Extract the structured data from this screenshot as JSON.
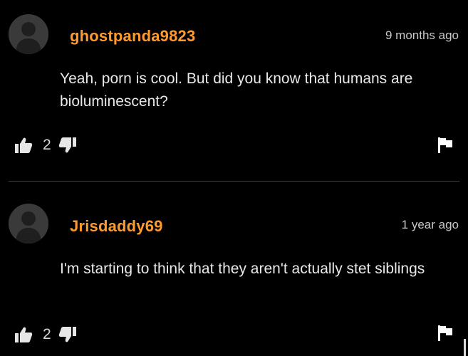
{
  "comments": [
    {
      "username": "ghostpanda9823",
      "time": "9 months ago",
      "text": "Yeah, porn is cool. But did you know that humans are bioluminescent?",
      "upvotes": "2"
    },
    {
      "username": "Jrisdaddy69",
      "time": "1 year ago",
      "text": "I'm starting to think that they aren't actually stet siblings",
      "upvotes": "2"
    }
  ],
  "colors": {
    "background": "#000000",
    "username": "#ff9a2e",
    "text": "#e8e8e8",
    "divider": "#3d3d3d"
  },
  "icons": {
    "avatar": "default-avatar-icon",
    "upvote": "thumbs-up-icon",
    "downvote": "thumbs-down-icon",
    "report": "flag-icon"
  }
}
